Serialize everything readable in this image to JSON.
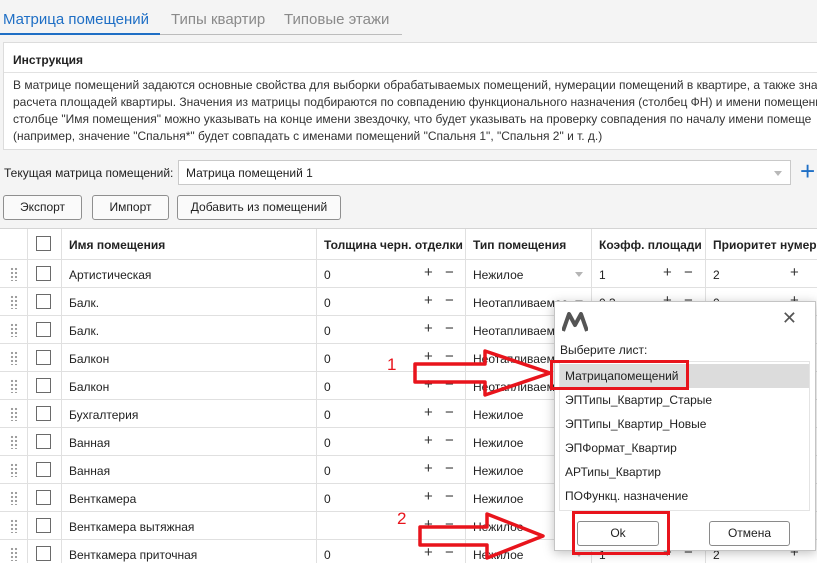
{
  "tabs": [
    "Матрица помещений",
    "Типы квартир",
    "Типовые этажи"
  ],
  "instruction": {
    "title": "Инструкция",
    "lines": [
      "В матрице помещений задаются основные свойства для выборки обрабатываемых помещений, нумерации помещений в квартире, а также знач",
      "расчета площадей квартиры. Значения из матрицы подбираются по совпадению функционального назначения (столбец ФН) и имени помещени",
      "столбце \"Имя помещения\" можно указывать на конце имени звездочку, что будет указывать на проверку совпадения по началу имени помеще",
      "(например, значение \"Спальня*\" будет совпадать с именами помещений \"Спальня 1\", \"Спальня 2\" и т. д.)"
    ]
  },
  "current_matrix": {
    "label": "Текущая матрица помещений:",
    "value": "Матрица помещений 1"
  },
  "toolbar": {
    "export": "Экспорт",
    "import": "Импорт",
    "add_from_rooms": "Добавить из помещений"
  },
  "table": {
    "headers": [
      "Имя помещения",
      "Толщина черн. отделки",
      "Тип помещения",
      "Коэфф. площади",
      "Приоритет нумера"
    ],
    "rows": [
      {
        "name": "Артистическая",
        "thickness": "0",
        "type": "Нежилое",
        "coef": "1",
        "priority": "2"
      },
      {
        "name": "Балк.",
        "thickness": "0",
        "type": "Неотапливаемое",
        "coef": "0,3",
        "priority": "0"
      },
      {
        "name": "Балк.",
        "thickness": "0",
        "type": "Неотапливаемое",
        "coef": "",
        "priority": ""
      },
      {
        "name": "Балкон",
        "thickness": "0",
        "type": "Неотапливаемое",
        "coef": "",
        "priority": ""
      },
      {
        "name": "Балкон",
        "thickness": "0",
        "type": "Неотапливаемое",
        "coef": "",
        "priority": ""
      },
      {
        "name": "Бухгалтерия",
        "thickness": "0",
        "type": "Нежилое",
        "coef": "",
        "priority": ""
      },
      {
        "name": "Ванная",
        "thickness": "0",
        "type": "Нежилое",
        "coef": "",
        "priority": ""
      },
      {
        "name": "Ванная",
        "thickness": "0",
        "type": "Нежилое",
        "coef": "",
        "priority": ""
      },
      {
        "name": "Венткамера",
        "thickness": "0",
        "type": "Нежилое",
        "coef": "",
        "priority": ""
      },
      {
        "name": "Венткамера вытяжная",
        "thickness": "",
        "type": "Нежилое",
        "coef": "",
        "priority": ""
      },
      {
        "name": "Венткамера приточная",
        "thickness": "0",
        "type": "Нежилое",
        "coef": "1",
        "priority": "2"
      }
    ]
  },
  "dialog": {
    "label": "Выберите лист:",
    "items": [
      "Матрицапомещений",
      "ЭПТипы_Квартир_Старые",
      "ЭПТипы_Квартир_Новые",
      "ЭПФормат_Квартир",
      "АРТипы_Квартир",
      "ПОФункц. назначение"
    ],
    "selected_index": 0,
    "ok": "Ok",
    "cancel": "Отмена"
  },
  "annotations": {
    "step1": "1",
    "step2": "2",
    "color": "#e8141c"
  },
  "colors": {
    "accent": "#1f6fc5",
    "annotation": "#e8141c"
  }
}
